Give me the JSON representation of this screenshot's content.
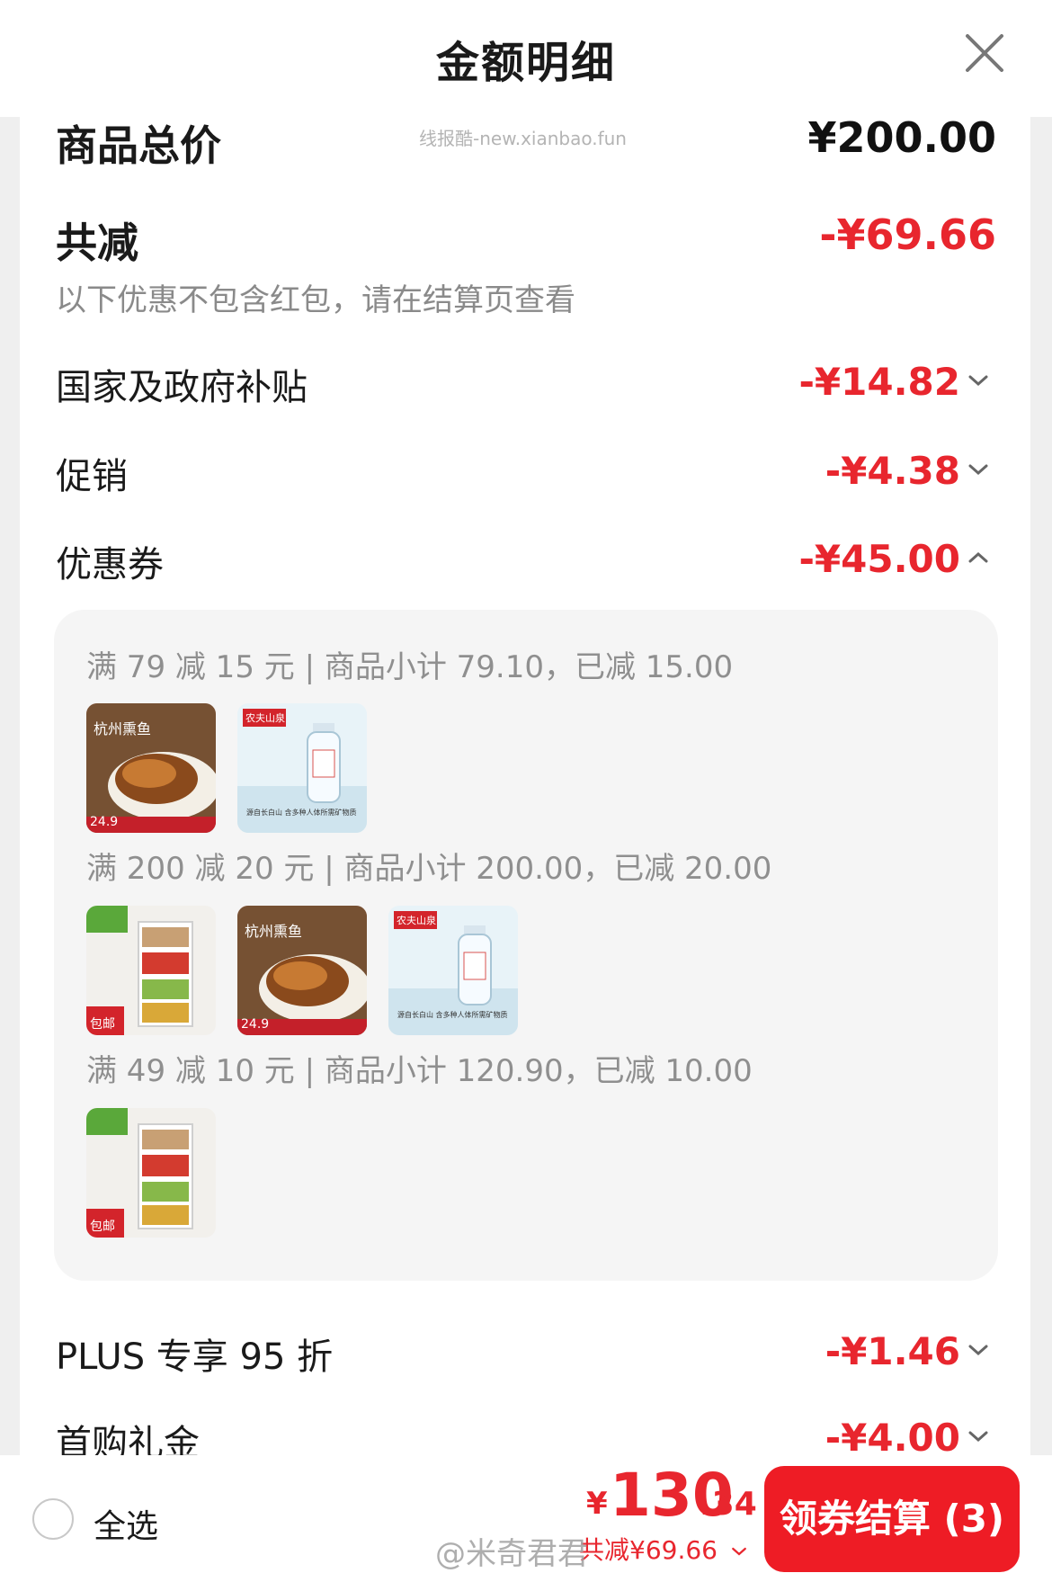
{
  "header": {
    "title": "金额明细"
  },
  "watermark": "线报酷-new.xianbao.fun",
  "summary": {
    "total_label": "商品总价",
    "total_amount": "¥200.00",
    "reduce_label": "共减",
    "reduce_amount": "-¥69.66",
    "reduce_note": "以下优惠不包含红包，请在结算页查看"
  },
  "discounts": [
    {
      "label": "国家及政府补贴",
      "amount": "-¥14.82",
      "expanded": false
    },
    {
      "label": "促销",
      "amount": "-¥4.38",
      "expanded": false
    },
    {
      "label": "优惠券",
      "amount": "-¥45.00",
      "expanded": true
    },
    {
      "label": "PLUS 专享 95 折",
      "amount": "-¥1.46",
      "expanded": false
    },
    {
      "label": "首购礼金",
      "amount": "-¥4.00",
      "expanded": false
    }
  ],
  "coupons": [
    {
      "text": "满 79 减 15 元 | 商品小计 79.10，已减 15.00",
      "products": [
        "fish-snack",
        "mineral-water"
      ]
    },
    {
      "text": "满 200 减 20 元 | 商品小计 200.00，已减 20.00",
      "products": [
        "storage-rack",
        "fish-snack",
        "mineral-water"
      ]
    },
    {
      "text": "满 49 减 10 元 | 商品小计 120.90，已减 10.00",
      "products": [
        "storage-rack"
      ]
    }
  ],
  "thumb_text": {
    "fish_price": "24.9",
    "fish_caption": "杭州熏鱼",
    "water_brand": "农夫山泉",
    "water_caption": "源自长白山 含多种人体所需矿物质",
    "rack_badge": "包邮"
  },
  "bottom": {
    "select_all": "全选",
    "currency": "¥",
    "price_int": "130",
    "price_dec": ".34",
    "reduce_summary": "共减¥69.66",
    "checkout_label": "领券结算 (3)",
    "weibo_mark": "@米奇君君"
  },
  "colors": {
    "accent": "#e8262e",
    "button": "#ee1c25",
    "coupon_bg": "#f5f5f5"
  },
  "icons": {
    "close": "close-icon",
    "expand": "chevron-down-icon",
    "collapse": "chevron-up-icon",
    "radio": "radio-unchecked-icon"
  }
}
